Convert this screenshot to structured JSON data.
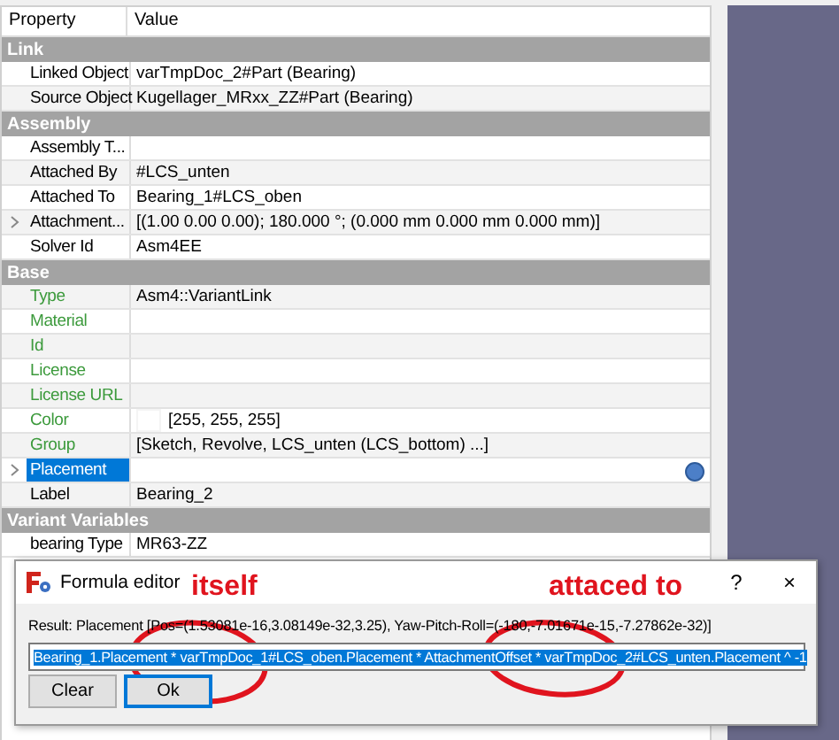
{
  "property_view": {
    "columns": [
      "Property",
      "Value"
    ],
    "groups": [
      {
        "title": "Link",
        "rows": [
          {
            "name": "Linked Object",
            "value": "varTmpDoc_2#Part (Bearing)",
            "selected": false
          },
          {
            "name": "Source Object",
            "value": "Kugellager_MRxx_ZZ#Part (Bearing)",
            "selected": false
          }
        ]
      },
      {
        "title": "Assembly",
        "rows": [
          {
            "name": "Assembly T...",
            "value": "",
            "selected": false
          },
          {
            "name": "Attached By",
            "value": "#LCS_unten",
            "selected": false
          },
          {
            "name": "Attached To",
            "value": "Bearing_1#LCS_oben",
            "selected": false
          },
          {
            "name": "Attachment...",
            "value": "[(1.00 0.00 0.00); 180.000 °; (0.000 mm  0.000 mm  0.000 mm)]",
            "selected": false,
            "expanded": false
          },
          {
            "name": "Solver Id",
            "value": "Asm4EE",
            "selected": false
          }
        ]
      },
      {
        "title": "Base",
        "rows": [
          {
            "name": "Type",
            "value": "Asm4::VariantLink",
            "selected": false,
            "color": "#3c9a3c"
          },
          {
            "name": "Material",
            "value": "",
            "selected": false,
            "color": "#3c9a3c"
          },
          {
            "name": "Id",
            "value": "",
            "selected": false,
            "color": "#3c9a3c"
          },
          {
            "name": "License",
            "value": "",
            "selected": false,
            "color": "#3c9a3c"
          },
          {
            "name": "License URL",
            "value": "",
            "selected": false,
            "color": "#3c9a3c"
          },
          {
            "name": "Color",
            "value": "[255, 255, 255]",
            "selected": false,
            "color": "#3c9a3c",
            "swatch": {
              "color": "#ffffff"
            }
          },
          {
            "name": "Group",
            "value": "[Sketch, Revolve, LCS_unten (LCS_bottom) ...]",
            "selected": false,
            "color": "#3c9a3c"
          },
          {
            "name": "Placement",
            "value": "",
            "selected": true,
            "expanded": false,
            "bound_expression": true
          },
          {
            "name": "Label",
            "value": "Bearing_2",
            "selected": false,
            "color": "#000000"
          }
        ]
      },
      {
        "title": "Variant Variables",
        "rows": [
          {
            "name": "bearing Type",
            "value": "MR63-ZZ",
            "selected": false
          }
        ]
      }
    ]
  },
  "formula_editor": {
    "title": "Formula editor",
    "help": "?",
    "close": "×",
    "result": "Result: Placement [Pos=(1.53081e-16,3.08149e-32,3.25), Yaw-Pitch-Roll=(-180,-7.01671e-15,-7.27862e-32)]",
    "expression": "Bearing_1.Placement * varTmpDoc_1#LCS_oben.Placement * AttachmentOffset * varTmpDoc_2#LCS_unten.Placement ^ -1",
    "buttons": [
      {
        "label": "Clear",
        "selected": false
      },
      {
        "label": "Ok",
        "selected": true
      }
    ]
  },
  "annotations": [
    {
      "text": "itself"
    },
    {
      "text": "attaced to"
    }
  ]
}
